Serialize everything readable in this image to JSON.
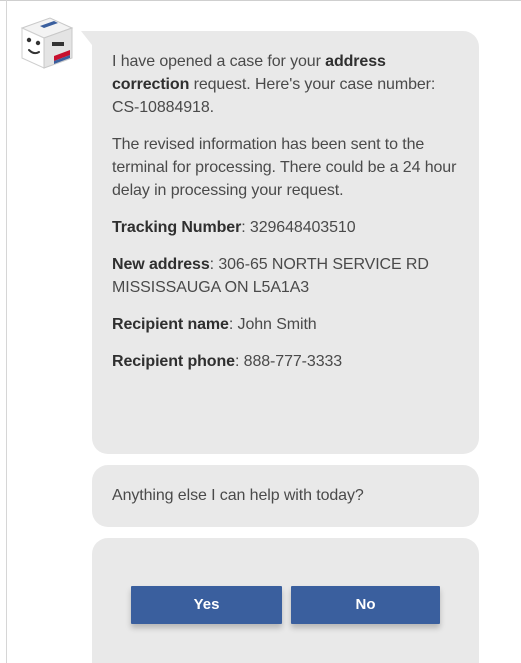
{
  "bot_message": {
    "p1_before": "I have opened a case for your ",
    "p1_bold": "address correction",
    "p1_after": " request. Here's your case number: CS-10884918.",
    "p2": "The revised information has been sent to the terminal for processing. There could be a 24 hour delay in processing your request.",
    "fields": [
      {
        "label": "Tracking Number",
        "value": ": 329648403510"
      },
      {
        "label": "New address",
        "value": ": 306-65 NORTH SERVICE RD MISSISSAUGA ON L5A1A3"
      },
      {
        "label": "Recipient name",
        "value": ": John Smith"
      },
      {
        "label": "Recipient phone",
        "value": ": 888-777-3333"
      }
    ]
  },
  "followup": {
    "text": "Anything else I can help with today?"
  },
  "quick_replies": {
    "yes_label": "Yes",
    "no_label": "No"
  },
  "colors": {
    "bubble": "#e9e9e9",
    "button": "#3a5f9e",
    "text": "#4a4a4a"
  },
  "icons": {
    "avatar": "cube-mascot-icon"
  }
}
